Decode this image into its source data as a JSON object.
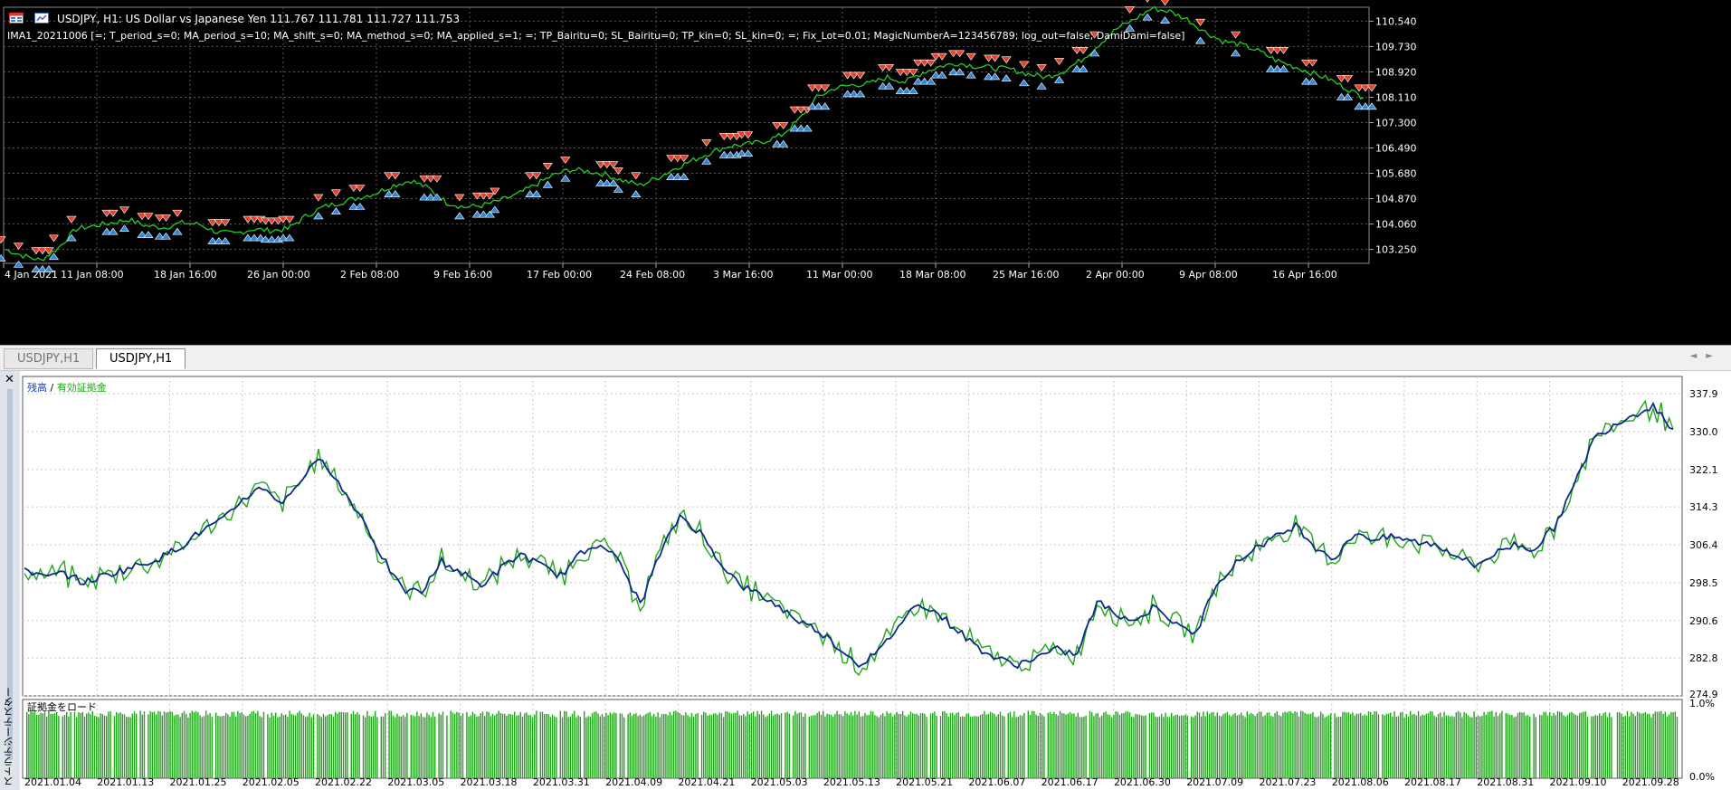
{
  "chart_window": {
    "symbol_title": "USDJPY, H1:  US Dollar vs Japanese Yen  111.767 111.781 111.727 111.753",
    "ea_info": "IMA1_20211006 [=; T_period_s=0; MA_period_s=10; MA_shift_s=0; MA_method_s=0; MA_applied_s=1; =; TP_Bairitu=0; SL_Bairitu=0; TP_kin=0; SL_kin=0; =; Fix_Lot=0.01; MagicNumberA=123456789; log_out=false; DamiDami=false]",
    "price_axis_labels": [
      "110.540",
      "109.730",
      "108.920",
      "108.110",
      "107.300",
      "106.490",
      "105.680",
      "104.870",
      "104.060",
      "103.250"
    ],
    "time_axis_labels": [
      "4 Jan 2021",
      "11 Jan 08:00",
      "18 Jan 16:00",
      "26 Jan 00:00",
      "2 Feb 08:00",
      "9 Feb 16:00",
      "17 Feb 00:00",
      "24 Feb 08:00",
      "3 Mar 16:00",
      "11 Mar 00:00",
      "18 Mar 08:00",
      "25 Mar 16:00",
      "2 Apr 00:00",
      "9 Apr 08:00",
      "16 Apr 16:00"
    ],
    "colors": {
      "background": "#000000",
      "grid": "#5a5a5a",
      "price_line": "#22d022",
      "sell_marker": "#e8412a",
      "buy_marker": "#2f87d8",
      "text": "#ffffff"
    }
  },
  "tabs": {
    "items": [
      {
        "label": "USDJPY,H1",
        "active": false
      },
      {
        "label": "USDJPY,H1",
        "active": true
      }
    ]
  },
  "tester": {
    "panel_label": "ストラテジーテスター",
    "legend": {
      "balance": "残高",
      "separator": "/",
      "equity": "有効証拠金"
    },
    "margin_title": "証拠金をロード",
    "balance_axis_labels": [
      "337.9",
      "330.0",
      "322.1",
      "314.3",
      "306.4",
      "298.5",
      "290.6",
      "282.8",
      "274.9"
    ],
    "margin_axis_labels": [
      "1.0%",
      "0.0%"
    ],
    "date_axis_labels": [
      "2021.01.04",
      "2021.01.13",
      "2021.01.25",
      "2021.02.05",
      "2021.02.22",
      "2021.03.05",
      "2021.03.18",
      "2021.03.31",
      "2021.04.09",
      "2021.04.21",
      "2021.05.03",
      "2021.05.13",
      "2021.05.21",
      "2021.06.07",
      "2021.06.17",
      "2021.06.30",
      "2021.07.09",
      "2021.07.23",
      "2021.08.06",
      "2021.08.17",
      "2021.08.31",
      "2021.09.10",
      "2021.09.28"
    ],
    "colors": {
      "balance": "#0b2a8c",
      "equity": "#22a51c",
      "grid": "#c8c8c8",
      "margin_bar": "#22a51c"
    }
  },
  "chart_data": [
    {
      "type": "line",
      "series": [
        {
          "values": [
            103.25,
            103.05,
            102.9,
            103.3,
            103.9,
            104.0,
            104.1,
            104.2,
            104.0,
            103.95,
            104.1,
            104.05,
            103.8,
            103.75,
            103.9,
            103.85,
            103.9,
            104.3,
            104.6,
            104.75,
            104.9,
            105.05,
            105.3,
            105.45,
            105.2,
            104.75,
            104.6,
            104.65,
            104.8,
            105.0,
            105.3,
            105.6,
            105.8,
            105.75,
            105.65,
            105.45,
            105.3,
            105.55,
            105.85,
            106.1,
            106.35,
            106.55,
            106.6,
            106.7,
            106.9,
            107.4,
            108.1,
            108.4,
            108.5,
            108.55,
            108.75,
            108.6,
            108.9,
            109.1,
            109.2,
            109.1,
            109.05,
            109.0,
            108.85,
            108.75,
            108.95,
            109.3,
            109.8,
            110.3,
            110.6,
            110.95,
            110.85,
            110.6,
            110.2,
            109.9,
            109.8,
            109.6,
            109.3,
            109.1,
            108.9,
            108.7,
            108.4,
            108.1
          ]
        }
      ]
    },
    {
      "type": "line",
      "series": [
        {
          "values": [
            301.5,
            299.5,
            300.5,
            298.5,
            300.0,
            301.2,
            302.5,
            304.0,
            306.5,
            309.5,
            311.5,
            316.0,
            318.5,
            315.0,
            320.5,
            324.5,
            318.0,
            312.0,
            304.0,
            297.0,
            296.5,
            303.0,
            300.5,
            298.0,
            301.5,
            304.5,
            302.0,
            300.0,
            304.5,
            307.0,
            302.5,
            294.0,
            304.5,
            312.5,
            309.0,
            303.0,
            298.0,
            296.0,
            293.5,
            290.5,
            288.5,
            285.0,
            281.5,
            284.0,
            289.5,
            294.5,
            292.0,
            288.5,
            285.0,
            282.5,
            281.5,
            283.0,
            284.5,
            283.5,
            294.5,
            292.0,
            290.5,
            294.0,
            289.5,
            288.0,
            298.5,
            302.5,
            306.0,
            308.0,
            310.5,
            306.0,
            303.5,
            309.0,
            307.5,
            308.0,
            307.0,
            306.5,
            304.5,
            302.0,
            304.5,
            306.5,
            305.5,
            310.0,
            318.5,
            328.5,
            331.5,
            333.5,
            335.5,
            330.5
          ]
        }
      ]
    },
    {
      "type": "bar",
      "values": [
        0.9
      ]
    }
  ]
}
